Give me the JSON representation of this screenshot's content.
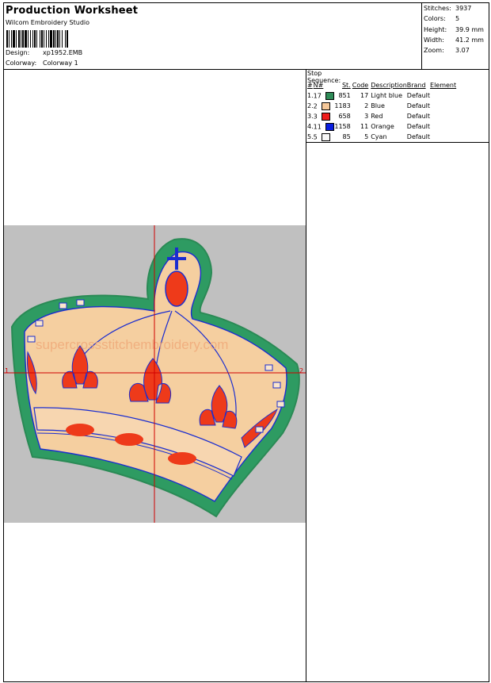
{
  "header": {
    "title": "Production Worksheet",
    "software": "Wilcom Embroidery Studio",
    "design_label": "Design:",
    "design_value": "xp1952.EMB",
    "colorway_label": "Colorway:",
    "colorway_value": "Colorway 1"
  },
  "stats": [
    {
      "label": "Stitches:",
      "value": "3937"
    },
    {
      "label": "Colors:",
      "value": "5"
    },
    {
      "label": "Height:",
      "value": "39.9 mm"
    },
    {
      "label": "Width:",
      "value": "41.2 mm"
    },
    {
      "label": "Zoom:",
      "value": "3.07"
    }
  ],
  "stop_sequence": {
    "title": "Stop Sequence:",
    "headers": [
      "#",
      "N#",
      "St.",
      "Code",
      "Description",
      "Brand",
      "Element"
    ],
    "rows": [
      {
        "num": "1.",
        "n": "17",
        "color": "#2e8b57",
        "st": "851",
        "code": "17",
        "desc": "Light blue",
        "brand": "Default"
      },
      {
        "num": "2.",
        "n": "2",
        "color": "#f5c89a",
        "st": "1183",
        "code": "2",
        "desc": "Blue",
        "brand": "Default"
      },
      {
        "num": "3.",
        "n": "3",
        "color": "#ee1c1c",
        "st": "658",
        "code": "3",
        "desc": "Red",
        "brand": "Default"
      },
      {
        "num": "4.",
        "n": "11",
        "color": "#0a1ee0",
        "st": "1158",
        "code": "11",
        "desc": "Orange",
        "brand": "Default"
      },
      {
        "num": "5.",
        "n": "5",
        "color": "#f8f8f8",
        "st": "85",
        "code": "5",
        "desc": "Cyan",
        "brand": "Default"
      }
    ]
  },
  "design": {
    "background_color": "#c0c0c0",
    "axis_color": "#d00000",
    "axis_label_left": "1",
    "axis_label_right": "2",
    "watermark": "supercrossstitchembroidery.com"
  }
}
